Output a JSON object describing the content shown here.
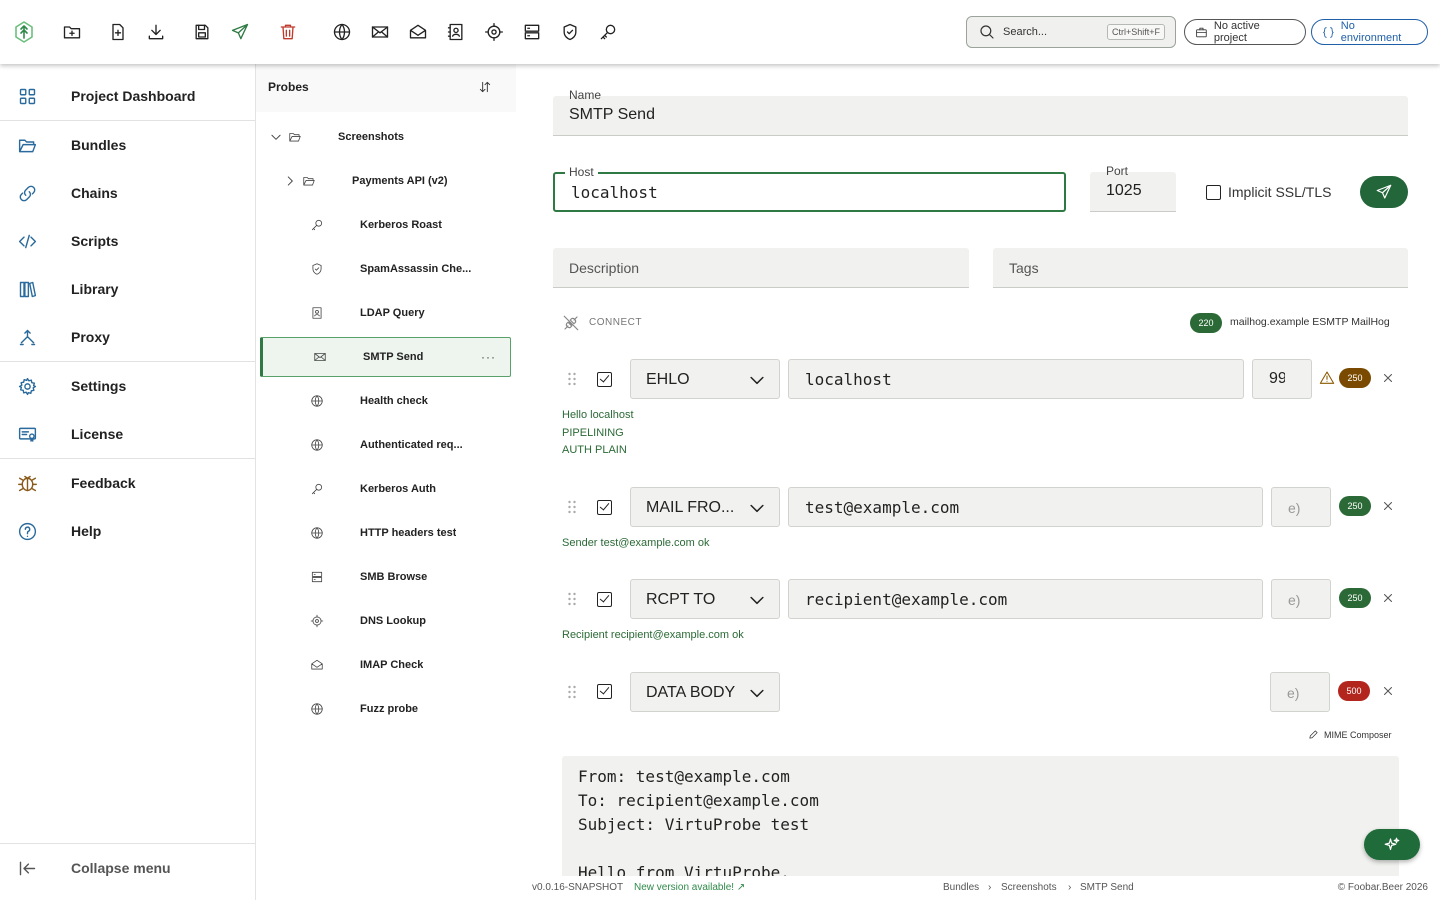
{
  "toolbar": {
    "search_placeholder": "Search...",
    "search_shortcut": "Ctrl+Shift+F",
    "project_label": "No active project",
    "environment_label": "No environment"
  },
  "nav": {
    "items": [
      {
        "label": "Project Dashboard",
        "icon": "grid-icon"
      },
      {
        "label": "Bundles",
        "icon": "folder-open-icon"
      },
      {
        "label": "Chains",
        "icon": "link-icon"
      },
      {
        "label": "Scripts",
        "icon": "code-icon"
      },
      {
        "label": "Library",
        "icon": "library-icon"
      },
      {
        "label": "Proxy",
        "icon": "proxy-icon"
      },
      {
        "label": "Settings",
        "icon": "gear-icon"
      },
      {
        "label": "License",
        "icon": "license-icon"
      },
      {
        "label": "Feedback",
        "icon": "bug-icon"
      },
      {
        "label": "Help",
        "icon": "help-icon"
      }
    ],
    "collapse_label": "Collapse menu"
  },
  "probes": {
    "title": "Probes",
    "tree": [
      {
        "label": "Screenshots",
        "icon": "folder-icon"
      },
      {
        "label": "Payments API (v2)",
        "icon": "folder-icon"
      },
      {
        "label": "Kerberos Roast",
        "icon": "key-icon"
      },
      {
        "label": "SpamAssassin Che...",
        "icon": "shield-icon"
      },
      {
        "label": "LDAP Query",
        "icon": "contact-icon"
      },
      {
        "label": "SMTP Send",
        "icon": "mail-icon"
      },
      {
        "label": "Health check",
        "icon": "globe-icon"
      },
      {
        "label": "Authenticated req...",
        "icon": "globe-icon"
      },
      {
        "label": "Kerberos Auth",
        "icon": "key-icon"
      },
      {
        "label": "HTTP headers test",
        "icon": "globe-icon"
      },
      {
        "label": "SMB Browse",
        "icon": "server-icon"
      },
      {
        "label": "DNS Lookup",
        "icon": "crosshair-icon"
      },
      {
        "label": "IMAP Check",
        "icon": "mail-open-icon"
      },
      {
        "label": "Fuzz probe",
        "icon": "globe-icon"
      }
    ],
    "more": "···"
  },
  "form": {
    "name_label": "Name",
    "name_value": "SMTP Send",
    "host_label": "Host",
    "host_value": "localhost",
    "port_label": "Port",
    "port_value": "1025",
    "ssl_label": "Implicit SSL/TLS",
    "description_label": "Description",
    "tags_label": "Tags"
  },
  "connect": {
    "label": "CONNECT",
    "code": "220",
    "message": "mailhog.example ESMTP MailHog"
  },
  "steps": [
    {
      "command": "EHLO",
      "arg": "localhost",
      "timeout": "99",
      "code": "250",
      "responses": [
        "Hello localhost",
        "PIPELINING",
        "AUTH PLAIN"
      ]
    },
    {
      "command": "MAIL FRO...",
      "arg": "test@example.com",
      "timeout_placeholder": "e)",
      "code": "250",
      "responses": [
        "Sender test@example.com ok"
      ]
    },
    {
      "command": "RCPT TO",
      "arg": "recipient@example.com",
      "timeout_placeholder": "e)",
      "code": "250",
      "responses": [
        "Recipient recipient@example.com ok"
      ]
    },
    {
      "command": "DATA BODY",
      "timeout_placeholder": "e)",
      "code": "500"
    }
  ],
  "mime_composer_label": "MIME Composer",
  "body_text": "From: test@example.com\nTo: recipient@example.com\nSubject: VirtuProbe test\n\nHello from VirtuProbe.",
  "footer": {
    "version": "v0.0.16-SNAPSHOT",
    "update": "New version available! ↗",
    "breadcrumb": [
      "Bundles",
      "Screenshots",
      "SMTP Send"
    ],
    "breadcrumb_sep": "›",
    "copyright": "© Foobar.Beer 2026"
  },
  "colors": {
    "accent_green": "#22663a",
    "nav_icon_blue": "#2a6a9c",
    "environment_blue": "#1f5fa8",
    "delete_red": "#c0392b",
    "error_red": "#b3261e",
    "warning_brown": "#7a4a00"
  }
}
